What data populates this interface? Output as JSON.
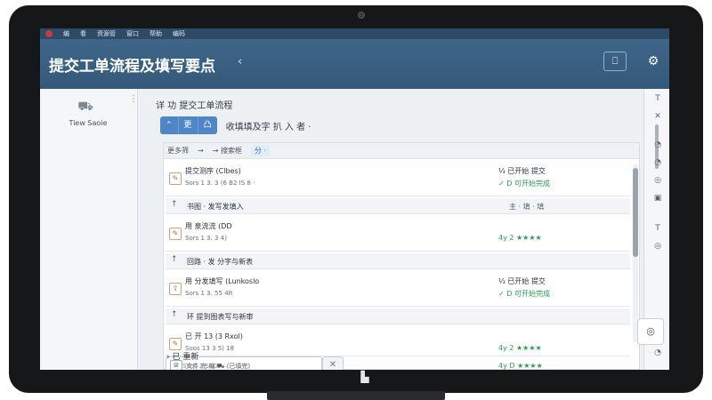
{
  "menubar": {
    "items": [
      "编",
      "看",
      "资源管",
      "窗口",
      "帮助",
      "编码"
    ]
  },
  "header": {
    "title": "提交工单流程及填写要点",
    "collapse_glyph": "‹",
    "clip_glyph": "⎕",
    "gear_glyph": "⚙"
  },
  "sidebar": {
    "more_glyph": "⋮",
    "avatar_glyph": "⛟",
    "user_label": "Tiew Saoie"
  },
  "main": {
    "breadcrumb": "详 功 提交工单流程",
    "actions": {
      "seg": [
        "⌃",
        "更",
        "凸"
      ],
      "label": "收填填及字 扒 入 者 ·"
    },
    "filter": {
      "items": [
        "更多筛",
        "→",
        "→ 搜索框"
      ],
      "chip": "分 ·"
    },
    "rows": [
      {
        "id": "r1",
        "line1": "提交测序 (Clbes)",
        "line2": "Sors 1 3. 3 (6 B2 IS 8 ·",
        "right1": "⅓ 已开始 提交",
        "right2": "✓ D 可开始完成",
        "icon": "✎"
      },
      {
        "id": "r2",
        "line1": "用 泉流流 (DD",
        "line2": "Sors 1 3. 3 4)",
        "right1": "",
        "right2": "4y 2 ★★★★",
        "icon": "✎"
      },
      {
        "id": "r3",
        "line1": "用 分发填写 (Lunkoslo",
        "line2": "Sors 1 3. 55 4R",
        "right1": "⅓ 已开始 提交",
        "right2": "✓ D 可开始完成",
        "icon": "⇧"
      },
      {
        "id": "r4",
        "line1": "已 开 13 (3 Rxol)",
        "line2": "Soos 13 3 5) 18",
        "right1": "",
        "right2": "4y 2 ★★★★",
        "icon": "✎"
      }
    ],
    "sections": [
      {
        "id": "s1",
        "arrow": "↑",
        "label": "书图 · 发写发填入",
        "right": "主 · 填 · 填"
      },
      {
        "id": "s2",
        "arrow": "↑",
        "label": "回路 · 发 分字与新表",
        "right": ""
      },
      {
        "id": "s3",
        "arrow": "↑",
        "label": "环 提到图表写与新审",
        "right": ""
      }
    ],
    "popup": {
      "icon": "⊠",
      "text": "文件 完 编 ⛟ (已填完)",
      "close_glyph": "✕",
      "right": "4y D ★★★★"
    },
    "footer": {
      "more": "› 已 重新",
      "sub": "Soos 2 SEG"
    }
  },
  "rail": {
    "icons": [
      "T",
      "✕",
      "◔",
      "◔",
      "◎",
      "▣",
      "T",
      "◎",
      "◔"
    ],
    "big_glyph": "◎"
  },
  "device": {
    "logo_glyph": "▙"
  }
}
